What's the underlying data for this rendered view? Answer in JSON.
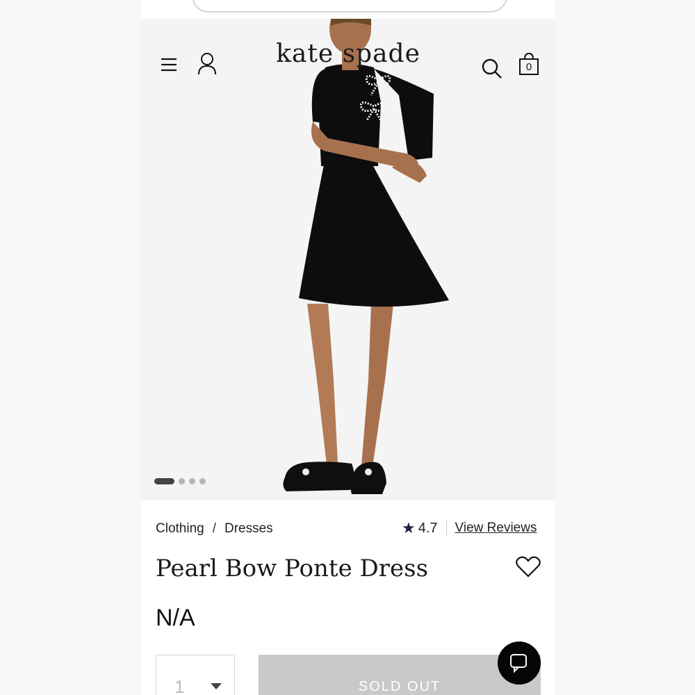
{
  "header": {
    "brand": "kate spade",
    "cart_count": "0",
    "icons": [
      "menu-icon",
      "account-icon",
      "search-icon",
      "shopping-bag-icon"
    ]
  },
  "carousel": {
    "image_count": 4,
    "active_index": 0
  },
  "breadcrumb": {
    "items": [
      "Clothing",
      "Dresses"
    ],
    "separator": "/"
  },
  "rating": {
    "value": "4.7",
    "reviews_link": "View Reviews"
  },
  "product": {
    "title": "Pearl Bow Ponte Dress",
    "price": "N/A"
  },
  "purchase": {
    "quantity": "1",
    "button_label": "SOLD OUT"
  },
  "colors": {
    "star": "#1d2340",
    "sold_out_bg": "#c9c9c9",
    "chat_bg": "#050505"
  }
}
